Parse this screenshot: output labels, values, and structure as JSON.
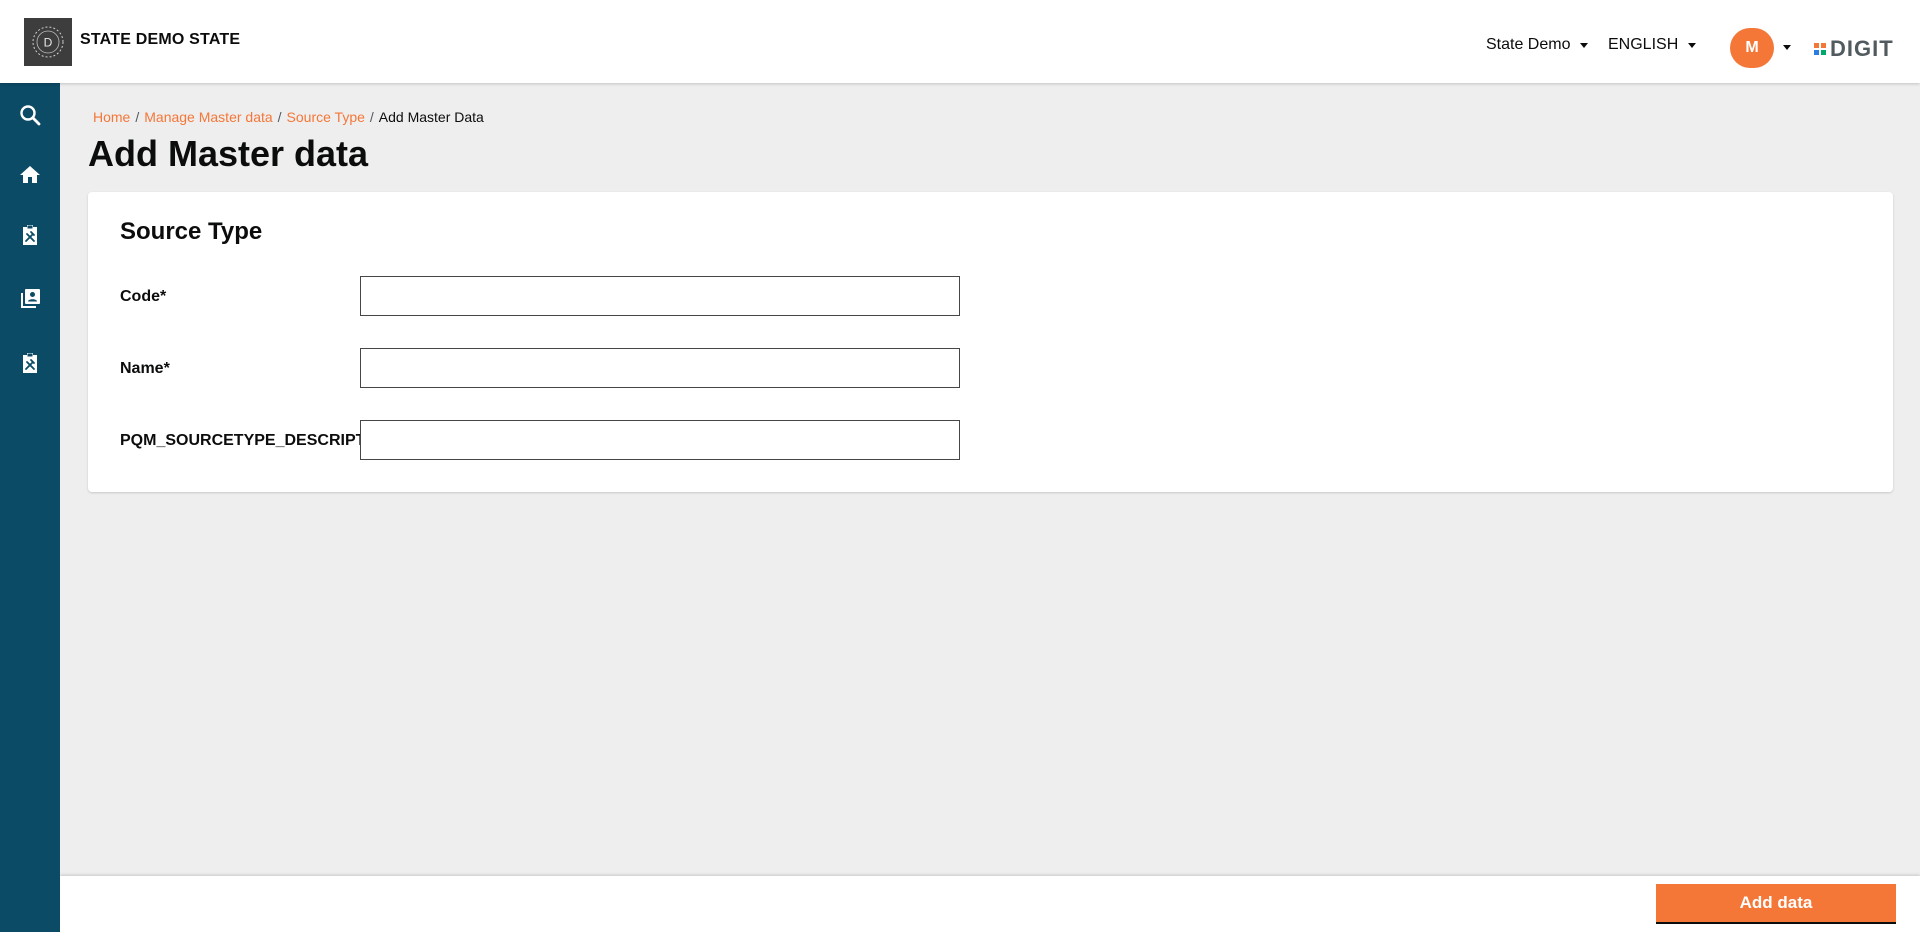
{
  "header": {
    "logo_letter": "D",
    "state_name": "STATE DEMO STATE",
    "city_selector": "State Demo",
    "language_selector": "ENGLISH",
    "avatar_initial": "M",
    "brand_logo_text": "DIGIT"
  },
  "sidebar": {
    "items": [
      {
        "icon": "search-icon"
      },
      {
        "icon": "home-icon"
      },
      {
        "icon": "tools-icon"
      },
      {
        "icon": "contacts-book-icon"
      },
      {
        "icon": "tools-icon"
      }
    ]
  },
  "breadcrumb": {
    "items": [
      "Home",
      "Manage Master data",
      "Source Type"
    ],
    "separator": "/",
    "current": "Add Master Data"
  },
  "page": {
    "title": "Add Master data"
  },
  "form": {
    "section_title": "Source Type",
    "fields": [
      {
        "label": "Code*",
        "value": ""
      },
      {
        "label": "Name*",
        "value": ""
      },
      {
        "label": "PQM_SOURCETYPE_DESCRIPTION",
        "value": ""
      }
    ]
  },
  "actions": {
    "submit_label": "Add data"
  },
  "colors": {
    "primary": "#f47738",
    "sidebar": "#0b4b66",
    "background": "#eeeeee"
  }
}
